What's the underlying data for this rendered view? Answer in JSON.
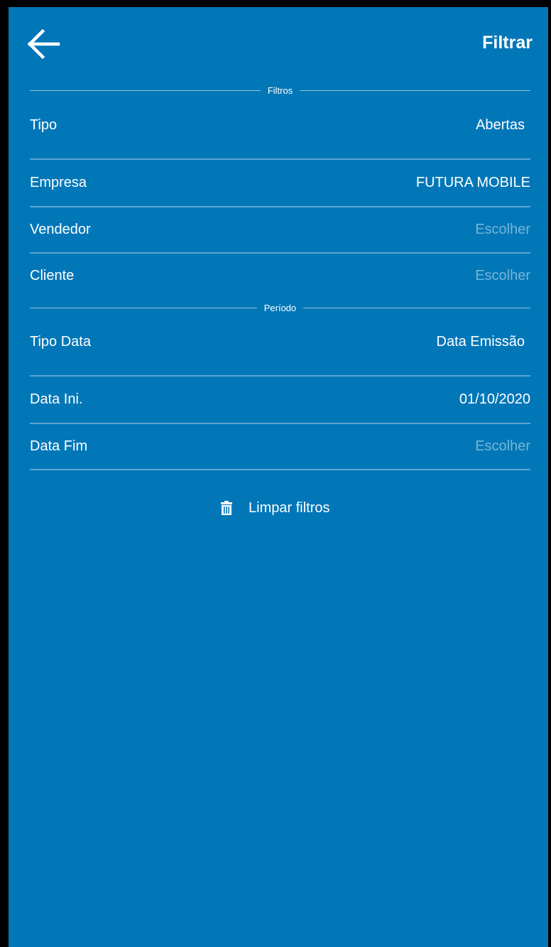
{
  "header": {
    "back_icon": "arrow-left-icon",
    "action_label": "Filtrar"
  },
  "sections": {
    "filtros": "Filtros",
    "periodo": "Período"
  },
  "fields": {
    "tipo": {
      "label": "Tipo",
      "value": "Abertas"
    },
    "empresa": {
      "label": "Empresa",
      "value": "FUTURA MOBILE"
    },
    "vendedor": {
      "label": "Vendedor",
      "placeholder": "Escolher"
    },
    "cliente": {
      "label": "Cliente",
      "placeholder": "Escolher"
    },
    "tipo_data": {
      "label": "Tipo Data",
      "value": "Data Emissão"
    },
    "data_ini": {
      "label": "Data Ini.",
      "value": "01/10/2020"
    },
    "data_fim": {
      "label": "Data Fim",
      "placeholder": "Escolher"
    }
  },
  "clear_button": {
    "icon": "trash-icon",
    "label": "Limpar filtros"
  },
  "colors": {
    "background": "#0277b8",
    "text": "#ffffff"
  }
}
